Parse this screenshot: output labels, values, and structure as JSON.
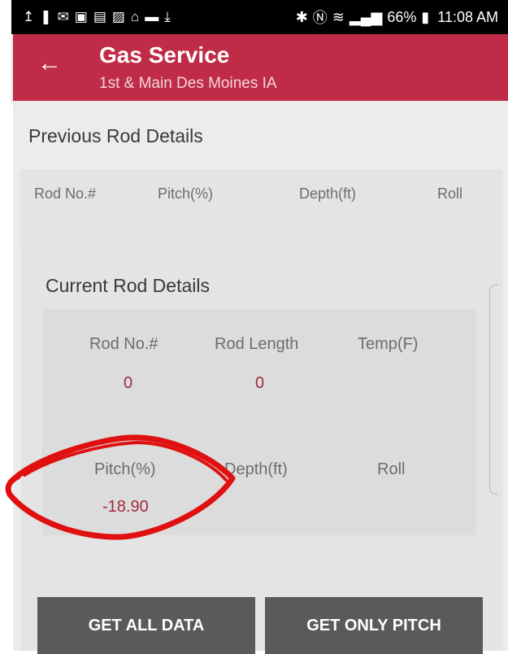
{
  "status_bar": {
    "left_icons": [
      "upload-icon",
      "person-icon",
      "mail-icon",
      "gallery-icon",
      "news-icon",
      "image-icon",
      "lock-icon",
      "video-icon",
      "download-icon"
    ],
    "battery": "66%",
    "time": "11:08 AM"
  },
  "app_bar": {
    "title": "Gas Service",
    "subtitle": "1st & Main Des Moines IA",
    "back_icon": "arrow-left-icon",
    "color": "#c02b47"
  },
  "previous": {
    "title": "Previous Rod Details",
    "columns": [
      "Rod No.#",
      "Pitch(%)",
      "Depth(ft)",
      "Roll"
    ]
  },
  "current": {
    "title": "Current Rod Details",
    "row1": {
      "rod_no_label": "Rod No.#",
      "rod_no_value": "0",
      "rod_length_label": "Rod Length",
      "rod_length_value": "0",
      "temp_label": "Temp(F)",
      "temp_value": ""
    },
    "row2": {
      "pitch_label": "Pitch(%)",
      "pitch_value": "-18.90",
      "depth_label": "Depth(ft)",
      "depth_value": "",
      "roll_label": "Roll",
      "roll_value": ""
    }
  },
  "buttons": {
    "get_all": "GET ALL DATA",
    "get_pitch": "GET ONLY PITCH"
  },
  "colors": {
    "value_text": "#a52a3c",
    "button": "#5a5a5a",
    "annotation": "#e01010"
  }
}
